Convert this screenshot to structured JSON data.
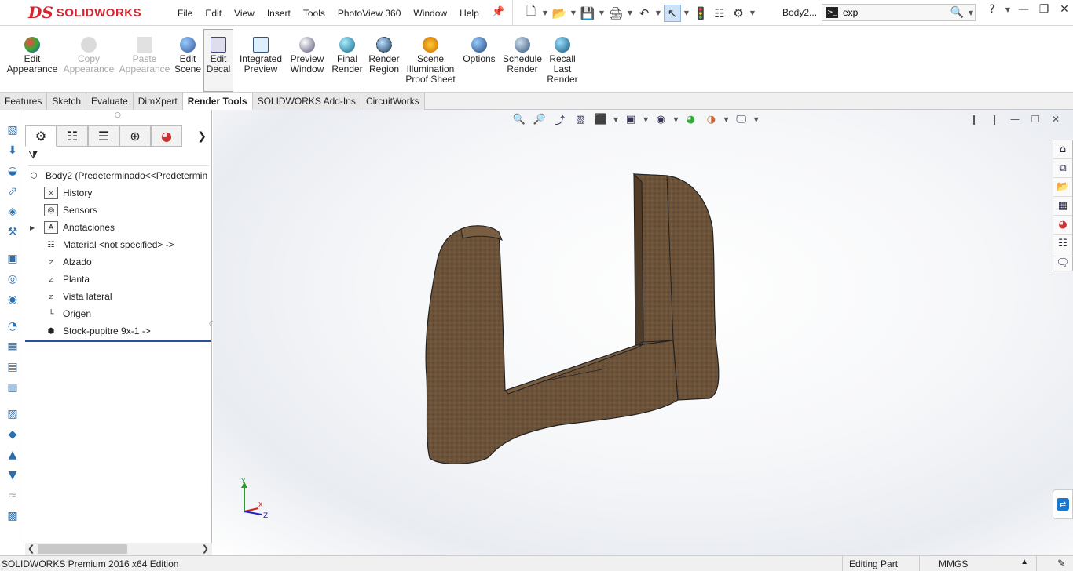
{
  "app": {
    "brand_mark": "DS",
    "brand_name": "SOLIDWORKS",
    "brand_color": "#d9232d",
    "document": "Body2...",
    "search_value": "exp",
    "help": "?"
  },
  "menu": [
    "File",
    "Edit",
    "View",
    "Insert",
    "Tools",
    "PhotoView 360",
    "Window",
    "Help"
  ],
  "quickbar_icons": [
    "new-document-icon",
    "open-icon",
    "save-icon",
    "print-icon",
    "undo-icon",
    "select-icon",
    "rebuild-icon",
    "file-properties-icon",
    "options-gear-icon"
  ],
  "commands": [
    {
      "label": "Edit\nAppearance",
      "icon": "edit-appearance-icon",
      "enabled": true
    },
    {
      "label": "Copy\nAppearance",
      "icon": "copy-appearance-icon",
      "enabled": false
    },
    {
      "label": "Paste\nAppearance",
      "icon": "paste-appearance-icon",
      "enabled": false
    },
    {
      "label": "Edit\nScene",
      "icon": "edit-scene-icon",
      "enabled": true
    },
    {
      "label": "Edit\nDecal",
      "icon": "edit-decal-icon",
      "enabled": true,
      "active": true
    },
    {
      "label": "Integrated\nPreview",
      "icon": "integrated-preview-icon",
      "enabled": true
    },
    {
      "label": "Preview\nWindow",
      "icon": "preview-window-icon",
      "enabled": true
    },
    {
      "label": "Final\nRender",
      "icon": "final-render-icon",
      "enabled": true
    },
    {
      "label": "Render\nRegion",
      "icon": "render-region-icon",
      "enabled": true
    },
    {
      "label": "Scene\nIllumination\nProof Sheet",
      "icon": "scene-illumination-icon",
      "enabled": true
    },
    {
      "label": "Options",
      "icon": "options-icon",
      "enabled": true
    },
    {
      "label": "Schedule\nRender",
      "icon": "schedule-render-icon",
      "enabled": true
    },
    {
      "label": "Recall\nLast\nRender",
      "icon": "recall-last-render-icon",
      "enabled": true
    }
  ],
  "tabs": [
    {
      "label": "Features",
      "active": false
    },
    {
      "label": "Sketch",
      "active": false
    },
    {
      "label": "Evaluate",
      "active": false
    },
    {
      "label": "DimXpert",
      "active": false
    },
    {
      "label": "Render Tools",
      "active": true
    },
    {
      "label": "SOLIDWORKS Add-Ins",
      "active": false
    },
    {
      "label": "CircuitWorks",
      "active": false
    }
  ],
  "tree": {
    "root": "Body2  (Predeterminado<<Predetermin",
    "items": [
      {
        "label": "History",
        "icon": "history-icon",
        "expandable": false
      },
      {
        "label": "Sensors",
        "icon": "sensors-icon",
        "expandable": false
      },
      {
        "label": "Anotaciones",
        "icon": "annotations-icon",
        "expandable": true
      },
      {
        "label": "Material <not specified> ->",
        "icon": "material-icon",
        "expandable": false
      },
      {
        "label": "Alzado",
        "icon": "plane-icon",
        "expandable": false
      },
      {
        "label": "Planta",
        "icon": "plane-icon",
        "expandable": false
      },
      {
        "label": "Vista lateral",
        "icon": "plane-icon",
        "expandable": false
      },
      {
        "label": "Origen",
        "icon": "origin-icon",
        "expandable": false
      },
      {
        "label": "Stock-pupitre 9x-1 ->",
        "icon": "part-icon",
        "expandable": false
      }
    ]
  },
  "triad": {
    "y": "Y",
    "x": "X",
    "z": "Z"
  },
  "model_color": "#6b5238",
  "status": {
    "edition": "SOLIDWORKS Premium 2016 x64 Edition",
    "mode": "Editing Part",
    "units": "MMGS"
  }
}
